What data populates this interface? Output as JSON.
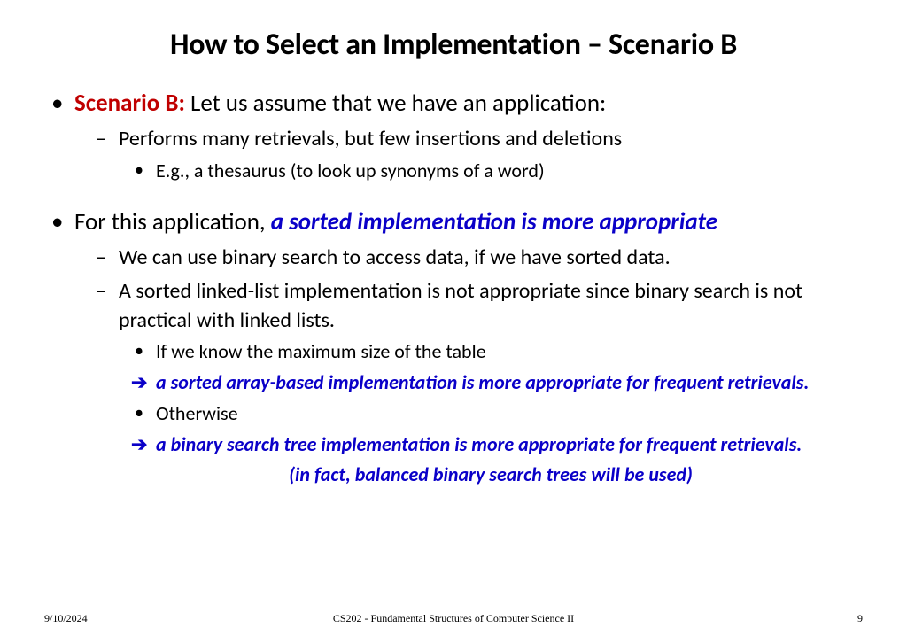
{
  "title": "How to Select an Implementation – Scenario B",
  "bullets": {
    "b1": {
      "label": "Scenario B:",
      "text": " Let us assume that we have an application:",
      "sub1": "Performs many retrievals, but few insertions and deletions",
      "sub1a": "E.g., a thesaurus (to look up synonyms of a word)"
    },
    "b2": {
      "prefix": "For this application, ",
      "emph": "a sorted implementation is more appropriate",
      "sub1": "We can use binary search to access data, if we have sorted data.",
      "sub2": "A sorted linked-list implementation is not appropriate since binary search is not practical with linked lists.",
      "sub2a": "If we know the maximum size of the table",
      "arrow1": "a sorted array-based implementation is more appropriate for frequent retrievals.",
      "sub2b": "Otherwise",
      "arrow2": "a binary search tree implementation is more appropriate for frequent retrievals.",
      "note": "(in fact, balanced binary search trees will be used)"
    }
  },
  "footer": {
    "date": "9/10/2024",
    "course": "CS202 - Fundamental Structures of Computer Science II",
    "page": "9"
  },
  "glyphs": {
    "arrow": "➔"
  }
}
